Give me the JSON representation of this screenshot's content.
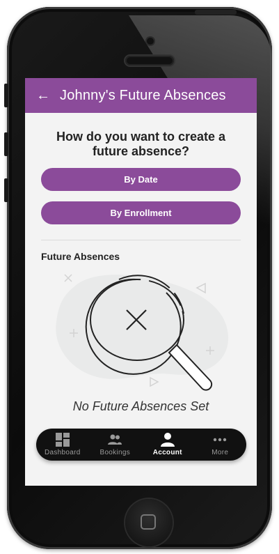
{
  "app_bar": {
    "back_icon": "arrow-left-icon",
    "title": "Johnny's Future Absences",
    "color": "#8b4b9a"
  },
  "create_section": {
    "question": "How do you want to create a future absence?",
    "by_date_label": "By Date",
    "by_enrollment_label": "By Enrollment"
  },
  "future_absences": {
    "heading": "Future Absences",
    "empty_icon": "magnifier-no-results-icon",
    "empty_message": "No Future Absences Set"
  },
  "bottom_nav": {
    "items": [
      {
        "label": "Dashboard",
        "icon": "dashboard-grid-icon",
        "active": false
      },
      {
        "label": "Bookings",
        "icon": "people-icon",
        "active": false
      },
      {
        "label": "Account",
        "icon": "person-icon",
        "active": true
      },
      {
        "label": "More",
        "icon": "more-dots-icon",
        "active": false
      }
    ]
  }
}
